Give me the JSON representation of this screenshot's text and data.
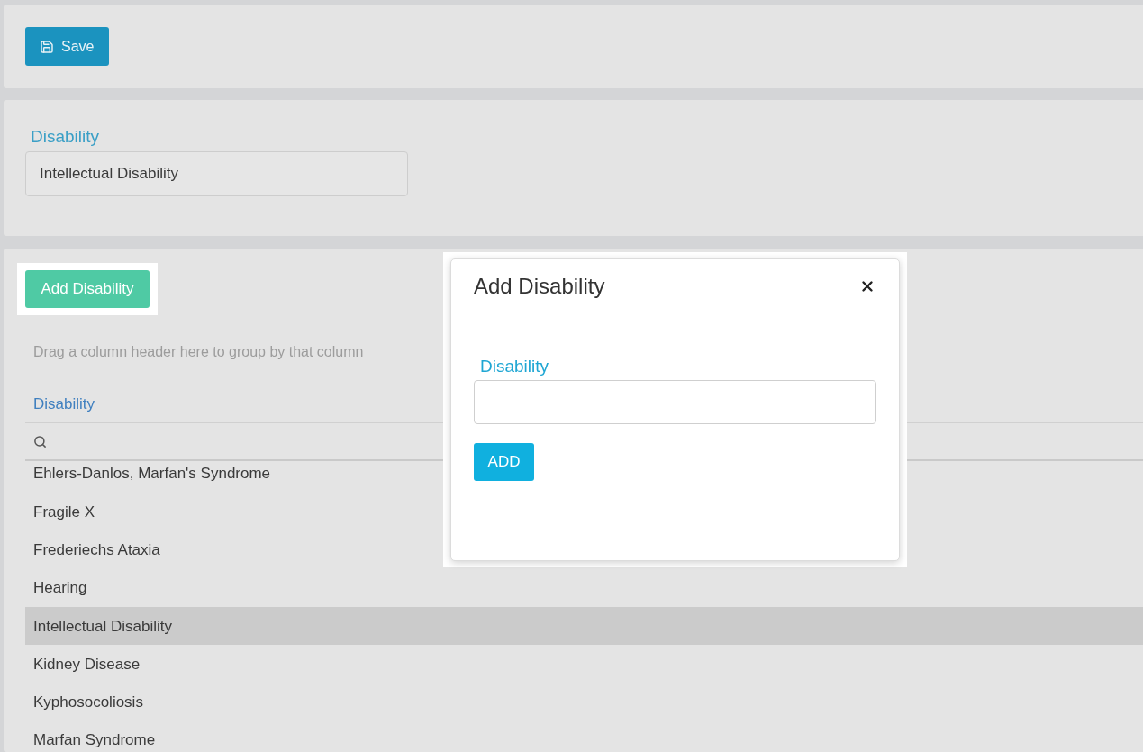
{
  "toolbar": {
    "save_button": {
      "label": "Save"
    }
  },
  "details": {
    "label": "Disability",
    "value": "Intellectual Disability"
  },
  "grid_panel": {
    "add_button": {
      "label": "Add Disability"
    },
    "group_panel_hint": "Drag a column header here to group by that column",
    "columns": [
      "Disability"
    ],
    "rows": [
      {
        "cells": [
          "Ehlers-Danlos, Marfan's Syndrome"
        ],
        "selected": false
      },
      {
        "cells": [
          "Fragile X"
        ],
        "selected": false
      },
      {
        "cells": [
          "Frederiechs Ataxia"
        ],
        "selected": false
      },
      {
        "cells": [
          "Hearing"
        ],
        "selected": false
      },
      {
        "cells": [
          "Intellectual Disability"
        ],
        "selected": true
      },
      {
        "cells": [
          "Kidney Disease"
        ],
        "selected": false
      },
      {
        "cells": [
          "Kyphosocoliosis"
        ],
        "selected": false
      },
      {
        "cells": [
          "Marfan Syndrome"
        ],
        "selected": false
      }
    ]
  },
  "dialog": {
    "title": "Add Disability",
    "field": {
      "label": "Disability"
    },
    "submit_button": {
      "label": "ADD"
    }
  }
}
